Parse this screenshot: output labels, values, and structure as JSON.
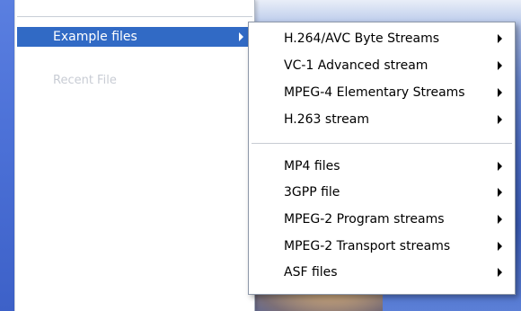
{
  "parent_menu": {
    "items": [
      {
        "label": "Example files",
        "selected": true,
        "has_submenu": true
      },
      {
        "label": "Recent File",
        "faded": true
      }
    ]
  },
  "submenu": {
    "groups": [
      {
        "items": [
          {
            "label": "H.264/AVC Byte Streams",
            "has_submenu": true
          },
          {
            "label": "VC-1 Advanced stream",
            "has_submenu": true
          },
          {
            "label": "MPEG-4 Elementary Streams",
            "has_submenu": true
          },
          {
            "label": "H.263 stream",
            "has_submenu": true
          }
        ]
      },
      {
        "items": [
          {
            "label": "MP4 files",
            "has_submenu": true
          },
          {
            "label": "3GPP file",
            "has_submenu": true
          },
          {
            "label": "MPEG-2 Program streams",
            "has_submenu": true
          },
          {
            "label": "MPEG-2 Transport streams",
            "has_submenu": true
          },
          {
            "label": "ASF files",
            "has_submenu": true
          }
        ]
      }
    ]
  },
  "colors": {
    "selection": "#316ac5",
    "menu_bg": "#ffffff",
    "separator": "#c7ccd3"
  }
}
